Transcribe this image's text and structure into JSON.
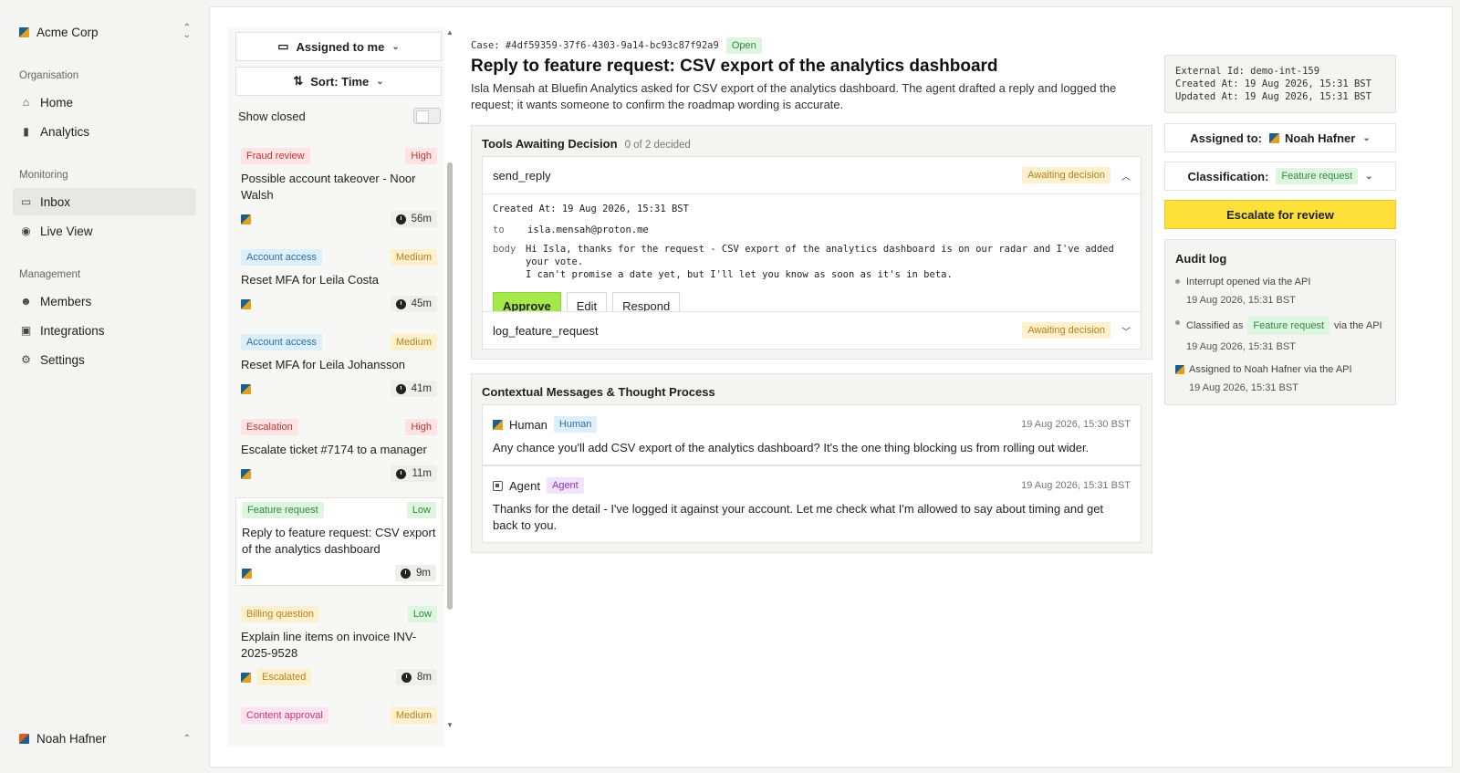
{
  "sidebar": {
    "org_name": "Acme Corp",
    "sections": {
      "organisation": "Organisation",
      "monitoring": "Monitoring",
      "management": "Management"
    },
    "items": {
      "home": "Home",
      "analytics": "Analytics",
      "inbox": "Inbox",
      "live_view": "Live View",
      "members": "Members",
      "integrations": "Integrations",
      "settings": "Settings"
    },
    "user_name": "Noah Hafner"
  },
  "list": {
    "assigned_filter": "Assigned to me",
    "sort": "Sort: Time",
    "show_closed": "Show closed",
    "cards": [
      {
        "tag": "Fraud review",
        "priority": "High",
        "title": "Possible account takeover - Noor Walsh",
        "time": "56m"
      },
      {
        "tag": "Account access",
        "priority": "Medium",
        "title": "Reset MFA for Leila Costa",
        "time": "45m"
      },
      {
        "tag": "Account access",
        "priority": "Medium",
        "title": "Reset MFA for Leila Johansson",
        "time": "41m"
      },
      {
        "tag": "Escalation",
        "priority": "High",
        "title": "Escalate ticket #7174 to a manager",
        "time": "11m"
      },
      {
        "tag": "Feature request",
        "priority": "Low",
        "title": "Reply to feature request: CSV export of the analytics dashboard",
        "time": "9m"
      },
      {
        "tag": "Billing question",
        "priority": "Low",
        "title": "Explain line items on invoice INV-2025-9528",
        "time": "8m",
        "status": "Escalated"
      },
      {
        "tag": "Content approval",
        "priority": "Medium"
      }
    ]
  },
  "case": {
    "id": "Case: #4df59359-37f6-4303-9a14-bc93c87f92a9",
    "status": "Open",
    "title": "Reply to feature request: CSV export of the analytics dashboard",
    "description": "Isla Mensah at Bluefin Analytics asked for CSV export of the analytics dashboard. The agent drafted a reply and logged the request; it wants someone to confirm the roadmap wording is accurate."
  },
  "tools": {
    "heading": "Tools Awaiting Decision",
    "progress": "0 of 2 decided",
    "items": [
      {
        "name": "send_reply",
        "state": "Awaiting decision",
        "created": "Created At: 19 Aug 2026, 15:31 BST",
        "to_label": "to",
        "to": "isla.mensah@proton.me",
        "body_label": "body",
        "body_line1": "Hi Isla, thanks for the request - CSV export of the analytics dashboard is on our radar and I've added your vote.",
        "body_line2": "I can't promise a date yet, but I'll let you know as soon as it's in beta.",
        "approve": "Approve",
        "edit": "Edit",
        "respond": "Respond"
      },
      {
        "name": "log_feature_request",
        "state": "Awaiting decision"
      }
    ]
  },
  "context": {
    "heading": "Contextual Messages & Thought Process",
    "messages": [
      {
        "author": "Human",
        "badge": "Human",
        "time": "19 Aug 2026, 15:30 BST",
        "text": "Any chance you'll add CSV export of the analytics dashboard? It's the one thing blocking us from rolling out wider."
      },
      {
        "author": "Agent",
        "badge": "Agent",
        "time": "19 Aug 2026, 15:31 BST",
        "text": "Thanks for the detail - I've logged it against your account. Let me check what I'm allowed to say about timing and get back to you."
      }
    ]
  },
  "meta": {
    "external_id": "External Id: demo-int-159",
    "created": "Created At: 19 Aug 2026, 15:31 BST",
    "updated": "Updated At: 19 Aug 2026, 15:31 BST"
  },
  "assignment": {
    "label": "Assigned to:",
    "value": "Noah Hafner"
  },
  "classification": {
    "label": "Classification:",
    "value": "Feature request"
  },
  "escalate": "Escalate for review",
  "audit": {
    "heading": "Audit log",
    "events": [
      {
        "text": "Interrupt opened via the API",
        "time": "19 Aug 2026, 15:31 BST"
      },
      {
        "pre": "Classified as",
        "tag": "Feature request",
        "post": "via the API",
        "time": "19 Aug 2026, 15:31 BST"
      },
      {
        "text": "Assigned to Noah Hafner via the API",
        "time": "19 Aug 2026, 15:31 BST"
      }
    ]
  }
}
